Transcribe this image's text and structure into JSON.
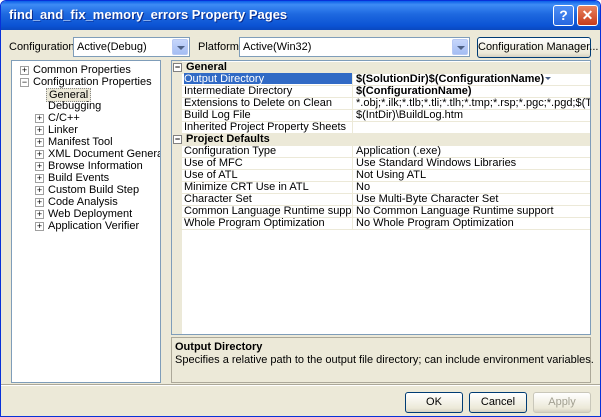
{
  "window": {
    "title": "find_and_fix_memory_errors Property Pages"
  },
  "titlebar": {
    "help_label": "?",
    "close_label": "✕"
  },
  "toolbar": {
    "configuration_label": "Configuration:",
    "configuration_value": "Active(Debug)",
    "platform_label": "Platform:",
    "platform_value": "Active(Win32)",
    "config_manager_label": "Configuration Manager..."
  },
  "tree": {
    "expanded_glyph": "−",
    "collapsed_glyph": "+",
    "items": [
      {
        "label": "Common Properties"
      },
      {
        "label": "Configuration Properties"
      },
      {
        "label": "General"
      },
      {
        "label": "Debugging"
      },
      {
        "label": "C/C++"
      },
      {
        "label": "Linker"
      },
      {
        "label": "Manifest Tool"
      },
      {
        "label": "XML Document Generator"
      },
      {
        "label": "Browse Information"
      },
      {
        "label": "Build Events"
      },
      {
        "label": "Custom Build Step"
      },
      {
        "label": "Code Analysis"
      },
      {
        "label": "Web Deployment"
      },
      {
        "label": "Application Verifier"
      }
    ]
  },
  "grid": {
    "categories": [
      {
        "label": "General",
        "rows": [
          {
            "name": "Output Directory",
            "value": "$(SolutionDir)$(ConfigurationName)"
          },
          {
            "name": "Intermediate Directory",
            "value": "$(ConfigurationName)"
          },
          {
            "name": "Extensions to Delete on Clean",
            "value": "*.obj;*.ilk;*.tlb;*.tli;*.tlh;*.tmp;*.rsp;*.pgc;*.pgd;$(TargetPath)"
          },
          {
            "name": "Build Log File",
            "value": "$(IntDir)\\BuildLog.htm"
          },
          {
            "name": "Inherited Project Property Sheets",
            "value": ""
          }
        ]
      },
      {
        "label": "Project Defaults",
        "rows": [
          {
            "name": "Configuration Type",
            "value": "Application (.exe)"
          },
          {
            "name": "Use of MFC",
            "value": "Use Standard Windows Libraries"
          },
          {
            "name": "Use of ATL",
            "value": "Not Using ATL"
          },
          {
            "name": "Minimize CRT Use in ATL",
            "value": "No"
          },
          {
            "name": "Character Set",
            "value": "Use Multi-Byte Character Set"
          },
          {
            "name": "Common Language Runtime support",
            "value": "No Common Language Runtime support"
          },
          {
            "name": "Whole Program Optimization",
            "value": "No Whole Program Optimization"
          }
        ]
      }
    ]
  },
  "description": {
    "title": "Output Directory",
    "text": "Specifies a relative path to the output file directory; can include environment variables."
  },
  "buttons": {
    "ok": "OK",
    "cancel": "Cancel",
    "apply": "Apply"
  }
}
